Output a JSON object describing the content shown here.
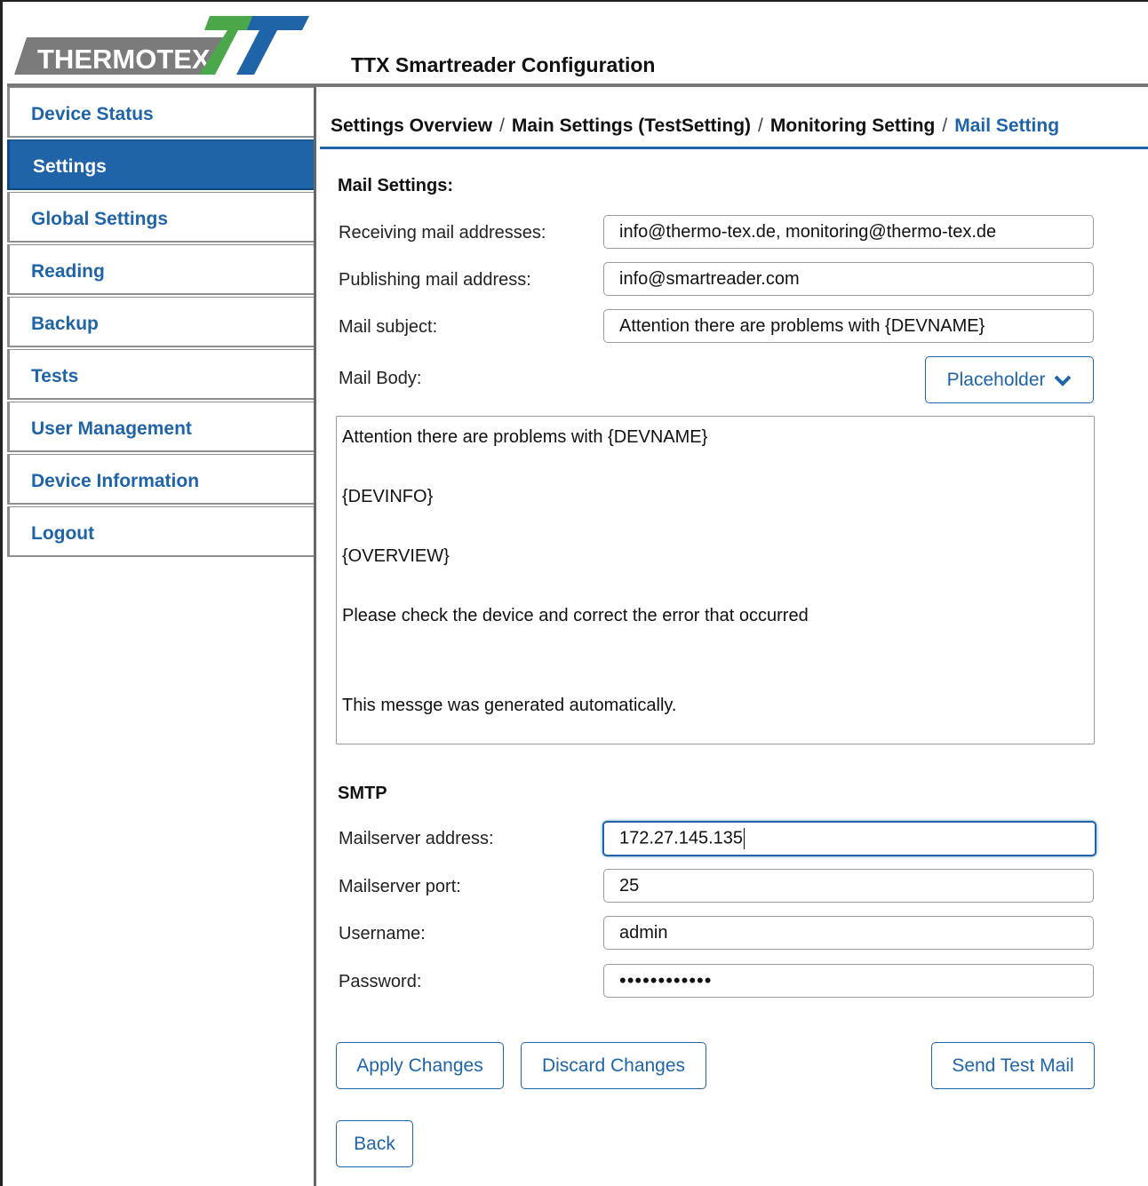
{
  "header": {
    "logo_text": "THERMOTEX",
    "title": "TTX Smartreader Configuration",
    "colors": {
      "logo_gray": "#7b7b7b",
      "logo_green": "#4aa84a",
      "logo_blue": "#1f64a8"
    }
  },
  "sidebar": {
    "items": [
      {
        "label": "Device Status",
        "active": false
      },
      {
        "label": "Settings",
        "active": true
      },
      {
        "label": "Global Settings",
        "active": false
      },
      {
        "label": "Reading",
        "active": false
      },
      {
        "label": "Backup",
        "active": false
      },
      {
        "label": "Tests",
        "active": false
      },
      {
        "label": "User Management",
        "active": false
      },
      {
        "label": "Device Information",
        "active": false
      },
      {
        "label": "Logout",
        "active": false
      }
    ]
  },
  "breadcrumb": {
    "items": [
      "Settings Overview",
      "Main Settings (TestSetting)",
      "Monitoring Setting",
      "Mail Setting"
    ],
    "separator": "/"
  },
  "mail": {
    "section_title": "Mail Settings:",
    "receiving_label": "Receiving mail addresses:",
    "receiving_value": "info@thermo-tex.de, monitoring@thermo-tex.de",
    "publishing_label": "Publishing mail address:",
    "publishing_value": "info@smartreader.com",
    "subject_label": "Mail subject:",
    "subject_value": "Attention there are problems with {DEVNAME}",
    "body_label": "Mail Body:",
    "placeholder_button": "Placeholder",
    "body_lines": [
      "Attention there are problems with {DEVNAME}",
      "{DEVINFO}",
      "{OVERVIEW}",
      "Please check the device and correct the error that occurred",
      "This messge was generated automatically."
    ]
  },
  "smtp": {
    "section_title": "SMTP",
    "server_label": "Mailserver address:",
    "server_value": "172.27.145.135",
    "port_label": "Mailserver port:",
    "port_value": "25",
    "username_label": "Username:",
    "username_value": "admin",
    "password_label": "Password:",
    "password_value": "••••••••••••"
  },
  "actions": {
    "apply": "Apply Changes",
    "discard": "Discard Changes",
    "test_mail": "Send Test Mail",
    "back": "Back"
  },
  "icons": {
    "placeholder_chevron": "chevron-down-icon"
  }
}
